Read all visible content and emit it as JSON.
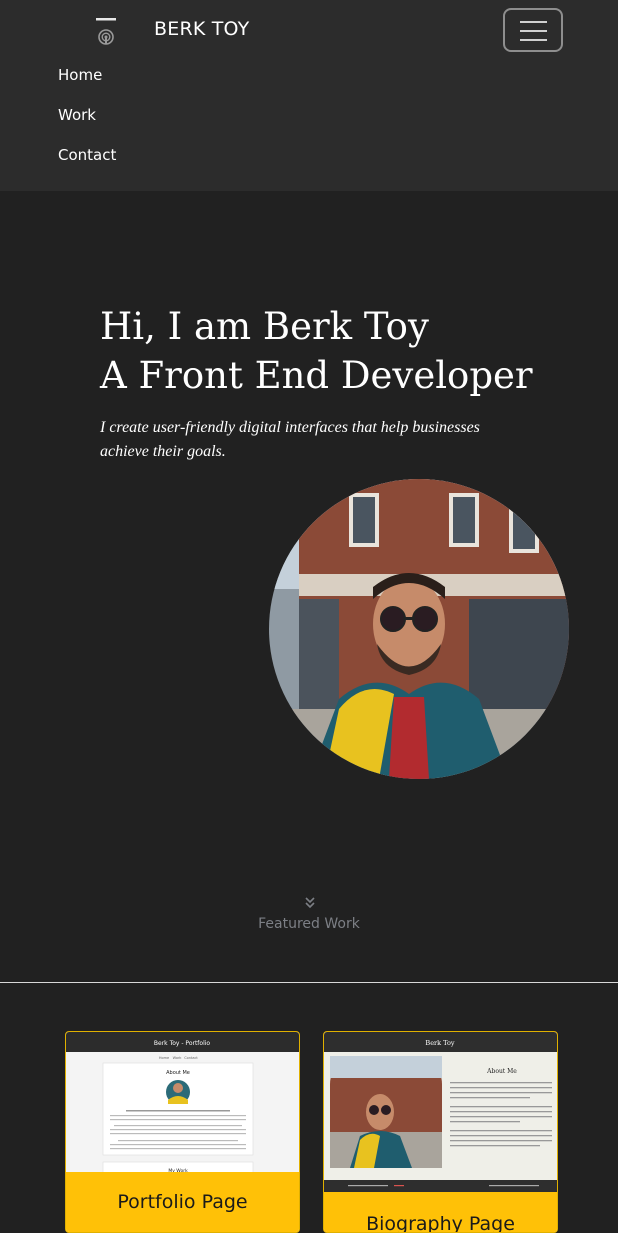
{
  "brand": {
    "name": "BERK TOY"
  },
  "nav": {
    "items": [
      "Home",
      "Work",
      "Contact"
    ],
    "toggle_icon": "hamburger-icon"
  },
  "hero": {
    "line1": "Hi, I am Berk Toy",
    "line2": "A Front End Developer",
    "subtitle": "I create user-friendly digital interfaces that help businesses achieve their goals."
  },
  "featured": {
    "label": "Featured Work",
    "icon": "double-chevron-down-icon"
  },
  "cards": [
    {
      "title": "Portfolio Page",
      "thumb": {
        "header": "Berk Toy - Portfolio",
        "nav": [
          "Home",
          "Work",
          "Contact"
        ],
        "section1": "About Me",
        "section2": "My Work"
      }
    },
    {
      "title": "Biography Page",
      "thumb": {
        "header": "Berk Toy",
        "section": "About Me"
      }
    }
  ],
  "colors": {
    "bg": "#212121",
    "navbar": "#2c2c2c",
    "accent": "#ffc107",
    "muted": "#7c7f85"
  }
}
